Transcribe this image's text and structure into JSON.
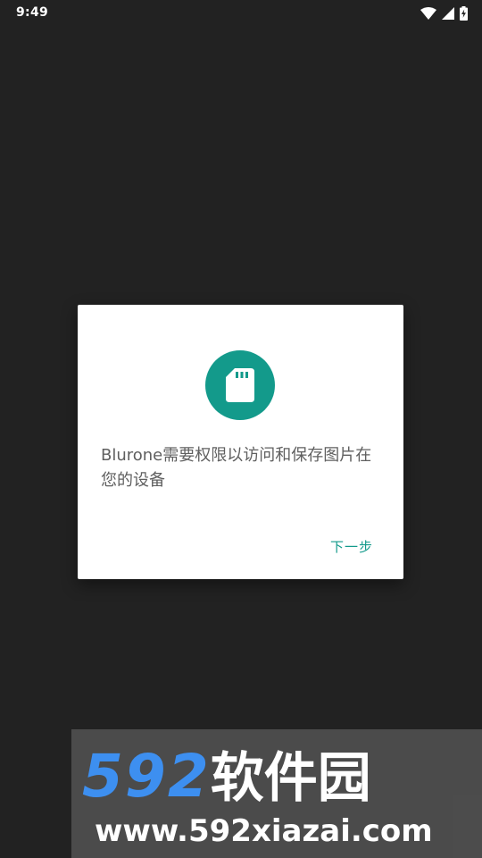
{
  "status_bar": {
    "time": "9:49",
    "icons": [
      "wifi-icon",
      "signal-icon",
      "battery-charging-icon"
    ]
  },
  "dialog": {
    "icon": "sd-card-icon",
    "message": "Blurone需要权限以访问和保存图片在您的设备",
    "next_button_label": "下一步"
  },
  "watermark": {
    "logo_number": "592",
    "logo_text": "软件园",
    "url": "www.592xiazai.com"
  },
  "colors": {
    "background": "#222222",
    "accent": "#139a8b",
    "dialog_bg": "#ffffff",
    "message_text": "#5f5f5f"
  }
}
